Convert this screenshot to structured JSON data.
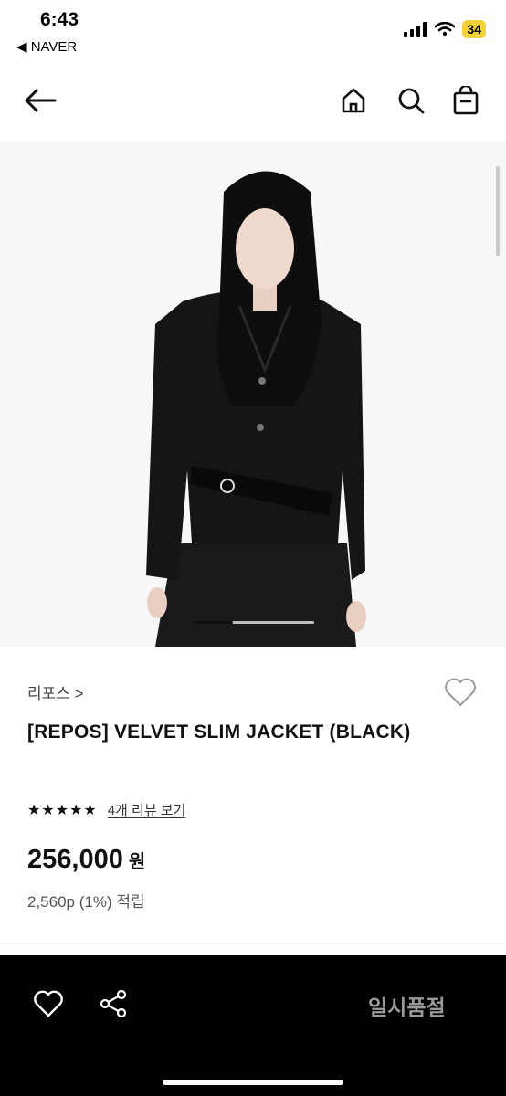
{
  "status_bar": {
    "time": "6:43",
    "back_app": "◀ NAVER",
    "battery": "34",
    "icons": [
      "signal-icon",
      "wifi-icon",
      "battery-icon"
    ]
  },
  "nav": {
    "icons": [
      "back-arrow-icon",
      "home-icon",
      "search-icon",
      "shopping-bag-icon"
    ]
  },
  "product": {
    "brand": "리포스 >",
    "title": "[REPOS] VELVET SLIM JACKET (BLACK)",
    "stars": "★★★★★",
    "review_link": "4개 리뷰 보기",
    "price": "256,000",
    "currency": "원",
    "points": "2,560p (1%) 적립",
    "image_alt": "model wearing black velvet slim jacket"
  },
  "bottom_bar": {
    "soldout_label": "일시품절",
    "icons": [
      "heart-icon",
      "share-icon"
    ]
  },
  "colors": {
    "background": "#ffffff",
    "bottom_bar": "#000000",
    "soldout_text": "#9a9a9a",
    "battery": "#f2d23a"
  }
}
